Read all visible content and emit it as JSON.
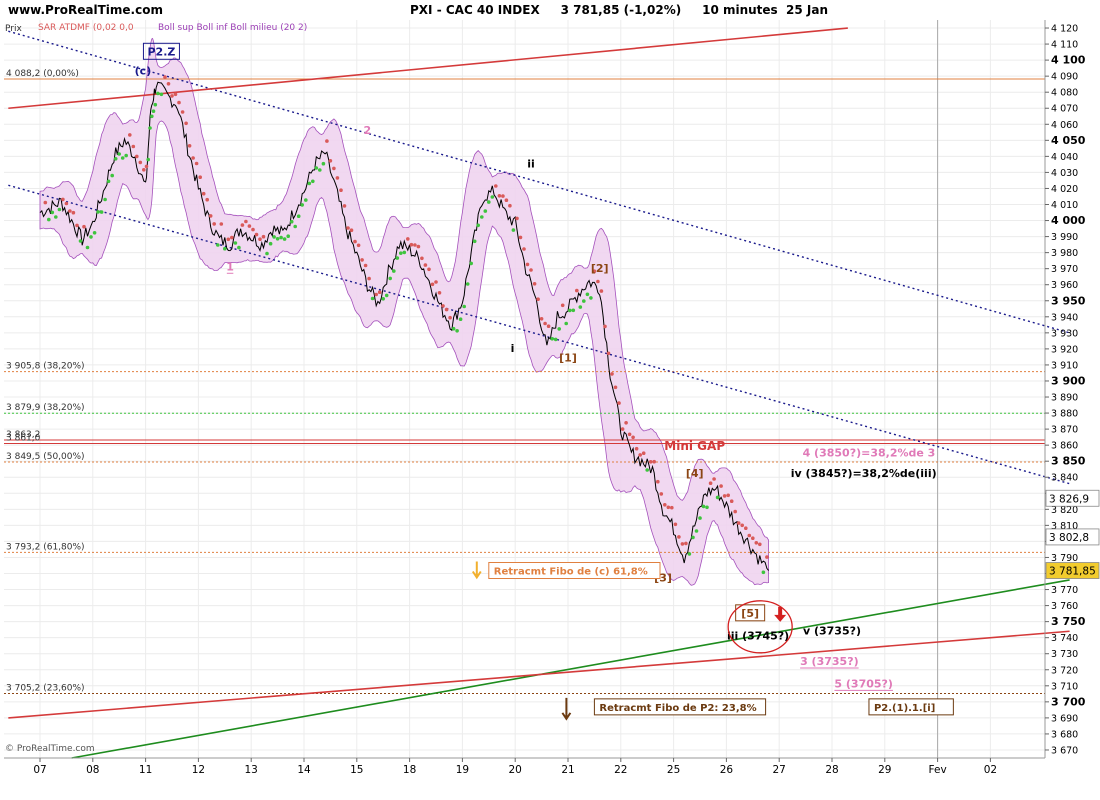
{
  "header": {
    "site": "www.ProRealTime.com",
    "title": "PXI - CAC 40 INDEX     3 781,85 (-1,02%)     10 minutes  25 Jan",
    "prix_label": "Prix",
    "legend_sar": "SAR ATDMF (0,02 0,0",
    "legend_boll": "Boll sup Boll inf Boll milieu (20 2)",
    "footer": "© ProRealTime.com"
  },
  "colors": {
    "price": "#000000",
    "boll_fill": "#f0d4f0",
    "boll_line": "#9b3fb5",
    "sar_up": "#3ec43e",
    "sar_down": "#d95a5a",
    "channel": "#1a1a8c",
    "trend_red": "#d43a3a",
    "trend_green": "#1e8c1e",
    "wave_pink": "#e07ab8",
    "fibo_orange": "#e08040"
  },
  "chart_data": {
    "type": "line",
    "title": "PXI - CAC 40 INDEX     3 781,85 (-1,02%)     10 minutes  25 Jan",
    "interval": "10 minutes",
    "last_price": "3 781,85",
    "change": "-1,02%",
    "x_ticks": [
      "07",
      "08",
      "11",
      "12",
      "13",
      "14",
      "15",
      "18",
      "19",
      "20",
      "21",
      "22",
      "25",
      "26",
      "27",
      "28",
      "29",
      "Fev",
      "02"
    ],
    "ylim": [
      3665,
      4125
    ],
    "y_ticks": [
      3670,
      3680,
      3690,
      3700,
      3710,
      3720,
      3730,
      3740,
      3750,
      3760,
      3770,
      3780,
      3790,
      3800,
      3810,
      3820,
      3830,
      3840,
      3850,
      3860,
      3870,
      3880,
      3890,
      3900,
      3910,
      3920,
      3930,
      3940,
      3950,
      3960,
      3970,
      3980,
      3990,
      4000,
      4010,
      4020,
      4030,
      4040,
      4050,
      4060,
      4070,
      4080,
      4090,
      4100,
      4110,
      4120
    ],
    "y_tick_labels": [
      "3 670",
      "3 680",
      "3 690",
      "3 700",
      "3 710",
      "3 720",
      "3 730",
      "3 740",
      "3 750",
      "3 760",
      "3 770",
      "3 780",
      "3 790",
      "3 800",
      "3 810",
      "3 820",
      "3 830",
      "3 840",
      "3 850",
      "3 860",
      "3 870",
      "3 880",
      "3 890",
      "3 900",
      "3 910",
      "3 920",
      "3 930",
      "3 940",
      "3 950",
      "3 960",
      "3 970",
      "3 980",
      "3 990",
      "4 000",
      "4 010",
      "4 020",
      "4 030",
      "4 040",
      "4 050",
      "4 060",
      "4 070",
      "4 080",
      "4 090",
      "4 100",
      "4 110",
      "4 120"
    ],
    "bold_y_ticks": [
      3700,
      3750,
      3800,
      3850,
      3900,
      3950,
      4000,
      4050,
      4100
    ],
    "grid": true,
    "price_path": [
      [
        0.0,
        4005
      ],
      [
        0.2,
        4008
      ],
      [
        0.4,
        4012
      ],
      [
        0.6,
        4000
      ],
      [
        0.8,
        3988
      ],
      [
        1.0,
        3998
      ],
      [
        1.2,
        4018
      ],
      [
        1.4,
        4040
      ],
      [
        1.6,
        4050
      ],
      [
        1.8,
        4040
      ],
      [
        2.0,
        4020
      ],
      [
        2.1,
        4070
      ],
      [
        2.2,
        4085
      ],
      [
        2.4,
        4078
      ],
      [
        2.6,
        4072
      ],
      [
        2.8,
        4045
      ],
      [
        3.0,
        4020
      ],
      [
        3.2,
        4000
      ],
      [
        3.4,
        3988
      ],
      [
        3.6,
        3985
      ],
      [
        3.8,
        3995
      ],
      [
        4.0,
        3990
      ],
      [
        4.2,
        3985
      ],
      [
        4.4,
        3995
      ],
      [
        4.6,
        3992
      ],
      [
        4.8,
        4005
      ],
      [
        5.0,
        4018
      ],
      [
        5.2,
        4035
      ],
      [
        5.4,
        4042
      ],
      [
        5.6,
        4020
      ],
      [
        5.8,
        3995
      ],
      [
        6.0,
        3978
      ],
      [
        6.2,
        3960
      ],
      [
        6.4,
        3948
      ],
      [
        6.6,
        3968
      ],
      [
        6.8,
        3985
      ],
      [
        7.0,
        3982
      ],
      [
        7.2,
        3975
      ],
      [
        7.4,
        3960
      ],
      [
        7.6,
        3945
      ],
      [
        7.8,
        3935
      ],
      [
        8.0,
        3950
      ],
      [
        8.2,
        3985
      ],
      [
        8.4,
        4015
      ],
      [
        8.6,
        4018
      ],
      [
        8.8,
        4005
      ],
      [
        9.0,
        3998
      ],
      [
        9.2,
        3970
      ],
      [
        9.4,
        3950
      ],
      [
        9.6,
        3920
      ],
      [
        9.8,
        3940
      ],
      [
        10.0,
        3945
      ],
      [
        10.2,
        3955
      ],
      [
        10.4,
        3962
      ],
      [
        10.6,
        3958
      ],
      [
        10.8,
        3905
      ],
      [
        11.0,
        3870
      ],
      [
        11.2,
        3855
      ],
      [
        11.4,
        3850
      ],
      [
        11.6,
        3845
      ],
      [
        11.8,
        3820
      ],
      [
        12.0,
        3808
      ],
      [
        12.2,
        3790
      ],
      [
        12.4,
        3810
      ],
      [
        12.6,
        3830
      ],
      [
        12.8,
        3833
      ],
      [
        13.0,
        3822
      ],
      [
        13.2,
        3810
      ],
      [
        13.4,
        3800
      ],
      [
        13.6,
        3790
      ],
      [
        13.8,
        3781.85
      ]
    ],
    "channel_lines": [
      {
        "name": "upper",
        "p1": [
          -0.6,
          4118
        ],
        "p2": [
          19.5,
          3930
        ]
      },
      {
        "name": "lower",
        "p1": [
          -0.6,
          4022
        ],
        "p2": [
          19.5,
          3836
        ]
      }
    ],
    "trend_lines": [
      {
        "name": "red-upper",
        "p1": [
          -0.6,
          4070
        ],
        "p2": [
          15.3,
          4120
        ]
      },
      {
        "name": "green",
        "p1": [
          0.6,
          3665
        ],
        "p2": [
          19.5,
          3776
        ]
      },
      {
        "name": "red-lower",
        "p1": [
          -0.6,
          3690
        ],
        "p2": [
          19.5,
          3744
        ]
      }
    ],
    "horizontal_levels": [
      {
        "value": 4088.2,
        "label": "4 088,2 (0,00%)",
        "style": "solid-orange"
      },
      {
        "value": 3905.8,
        "label": "3 905,8 (38,20%)",
        "style": "dotted-orange"
      },
      {
        "value": 3879.9,
        "label": "3 879,9 (38,20%)",
        "style": "dotted-green"
      },
      {
        "value": 3863.2,
        "label": "3 863,2",
        "style": "solid-red"
      },
      {
        "value": 3861.0,
        "label": "3 861,0",
        "style": "solid-red"
      },
      {
        "value": 3849.5,
        "label": "3 849,5 (50,00%)",
        "style": "dotted-orange"
      },
      {
        "value": 3793.2,
        "label": "3 793,2 (61,80%)",
        "style": "dotted-orange"
      },
      {
        "value": 3705.2,
        "label": "3 705,2 (23,60%)",
        "style": "dotted-brown"
      }
    ],
    "price_markers": [
      {
        "value": 3826.9,
        "label": "3 826,9",
        "bg": "#ffffff"
      },
      {
        "value": 3802.8,
        "label": "3 802,8",
        "bg": "#ffffff"
      },
      {
        "value": 3781.85,
        "label": "3 781,85",
        "bg": "#f2cc2e"
      }
    ],
    "wave_labels": [
      {
        "text": "(c)",
        "x": 1.95,
        "y": 4091,
        "color": "#1a1a8c"
      },
      {
        "text": "P2.Z",
        "x": 2.3,
        "y": 4103,
        "color": "#1a1a8c",
        "boxed": true
      },
      {
        "text": "1",
        "x": 3.6,
        "y": 3969,
        "color": "#e07ab8",
        "underline": true
      },
      {
        "text": "2",
        "x": 6.2,
        "y": 4054,
        "color": "#e07ab8"
      },
      {
        "text": "ii",
        "x": 9.3,
        "y": 4033,
        "color": "#000000"
      },
      {
        "text": "i",
        "x": 8.95,
        "y": 3918,
        "color": "#000000"
      },
      {
        "text": "[1]",
        "x": 10.0,
        "y": 3912,
        "color": "#8b4513"
      },
      {
        "text": "[2]",
        "x": 10.6,
        "y": 3968,
        "color": "#8b4513"
      },
      {
        "text": "[3]",
        "x": 11.8,
        "y": 3775,
        "color": "#8b4513"
      },
      {
        "text": "[4]",
        "x": 12.4,
        "y": 3840,
        "color": "#8b4513"
      },
      {
        "text": "[5]",
        "x": 13.45,
        "y": 3753,
        "color": "#8b4513",
        "boxed": true
      },
      {
        "text": "Mini GAP",
        "x": 12.4,
        "y": 3857,
        "color": "#d43a3a"
      },
      {
        "text": "4 (3850?)=38,2%de 3",
        "x": 15.7,
        "y": 3853,
        "color": "#e07ab8"
      },
      {
        "text": "iv (3845?)=38,2%de(iii)",
        "x": 15.6,
        "y": 3840,
        "color": "#000000"
      },
      {
        "text": "iii (3745?)",
        "x": 13.6,
        "y": 3739,
        "color": "#000000"
      },
      {
        "text": "v (3735?)",
        "x": 15.0,
        "y": 3742,
        "color": "#000000"
      },
      {
        "text": "3 (3735?)",
        "x": 14.95,
        "y": 3723,
        "color": "#e07ab8",
        "underline": true
      },
      {
        "text": "5 (3705?)",
        "x": 15.6,
        "y": 3709,
        "color": "#e07ab8",
        "underline": true
      }
    ],
    "annotations": [
      {
        "text": "Retracmt Fibo de (c) 61,8%",
        "x": 8.5,
        "y": 3780,
        "color": "#e08040"
      },
      {
        "text": "Retracmt Fibo de P2: 23,8%",
        "x": 10.5,
        "y": 3695,
        "color": "#6b3a10"
      },
      {
        "text": "P2.(1).1.[i]",
        "x": 15.7,
        "y": 3695,
        "color": "#6b3a10"
      }
    ]
  }
}
